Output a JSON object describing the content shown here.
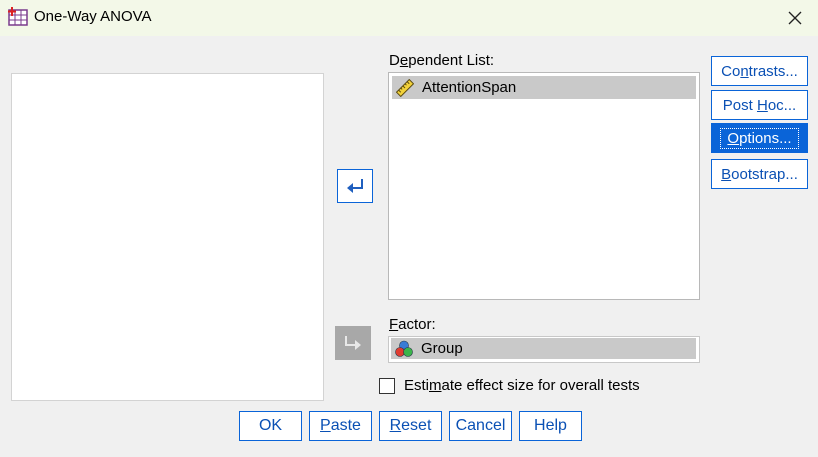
{
  "window": {
    "title": "One-Way ANOVA",
    "close_glyph": "✕"
  },
  "dependent_list": {
    "label_pre": "D",
    "label_u": "e",
    "label_post": "pendent List:",
    "items": [
      {
        "name": "AttentionSpan",
        "icon": "ruler-scale-icon"
      }
    ]
  },
  "factor": {
    "label_u": "F",
    "label_post": "actor:",
    "value": "Group",
    "icon": "nominal-variable-icon"
  },
  "checkbox": {
    "label_pre": "Estimate effect size for overall tests",
    "checked": false
  },
  "side_buttons": [
    {
      "pre": "Co",
      "u": "n",
      "post": "trasts..."
    },
    {
      "pre": "Post ",
      "u": "H",
      "post": "oc..."
    },
    {
      "pre": "",
      "u": "O",
      "post": "ptions..."
    },
    {
      "pre": "",
      "u": "B",
      "post": "ootstrap..."
    }
  ],
  "bottom_buttons": [
    {
      "pre": "OK",
      "u": "",
      "post": ""
    },
    {
      "pre": "",
      "u": "P",
      "post": "aste"
    },
    {
      "pre": "",
      "u": "R",
      "post": "eset"
    },
    {
      "pre": "Cancel",
      "u": "",
      "post": ""
    },
    {
      "pre": "Help",
      "u": "",
      "post": ""
    }
  ],
  "colors": {
    "accent": "#0a64d8",
    "titlebar": "#f3f8e8",
    "selection": "#c9c9c9"
  }
}
